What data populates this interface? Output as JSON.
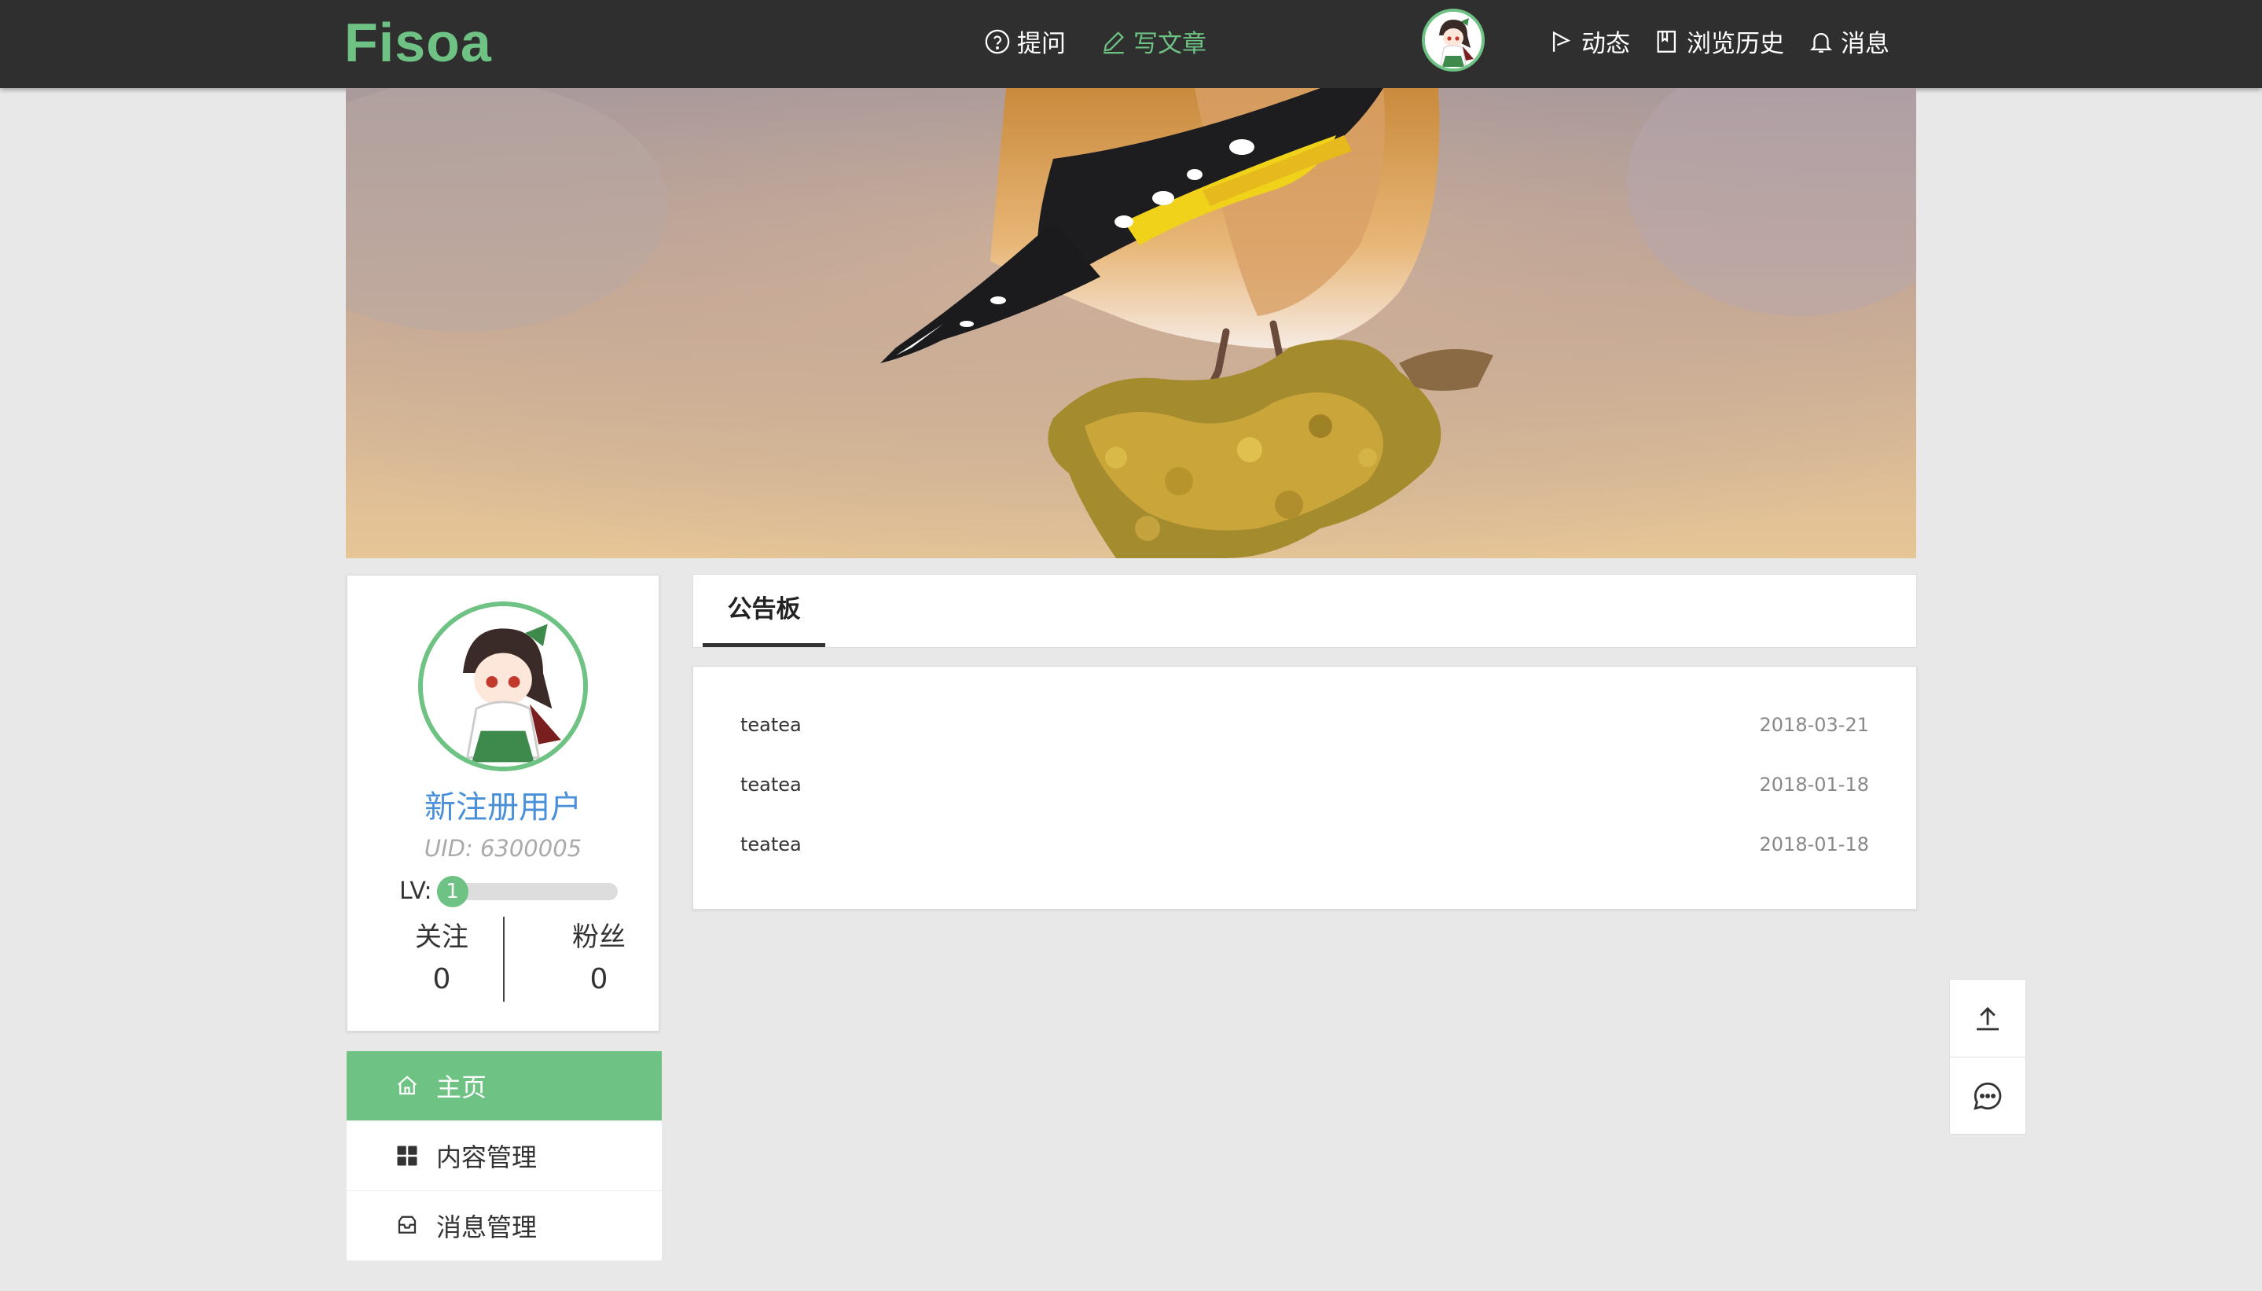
{
  "app": {
    "logo": "Fisoa"
  },
  "topnav": {
    "ask_label": "提问",
    "write_label": "写文章",
    "activity_label": "动态",
    "history_label": "浏览历史",
    "messages_label": "消息"
  },
  "profile": {
    "username": "新注册用户",
    "uid": "UID: 6300005",
    "level_label": "LV:",
    "level": "1",
    "level_progress": 0.12,
    "following_label": "关注",
    "following_count": "0",
    "followers_label": "粉丝",
    "followers_count": "0"
  },
  "sidemenu": {
    "items": [
      {
        "label": "主页",
        "icon": "home-icon",
        "active": true
      },
      {
        "label": "内容管理",
        "icon": "grid-icon",
        "active": false
      },
      {
        "label": "消息管理",
        "icon": "inbox-icon",
        "active": false
      }
    ]
  },
  "board": {
    "tab_label": "公告板",
    "items": [
      {
        "title": "teatea",
        "date": "2018-03-21"
      },
      {
        "title": "teatea",
        "date": "2018-01-18"
      },
      {
        "title": "teatea",
        "date": "2018-01-18"
      }
    ]
  },
  "colors": {
    "accent": "#6ec283",
    "topbar": "#2f2f2f",
    "link_blue": "#4a90d9"
  }
}
